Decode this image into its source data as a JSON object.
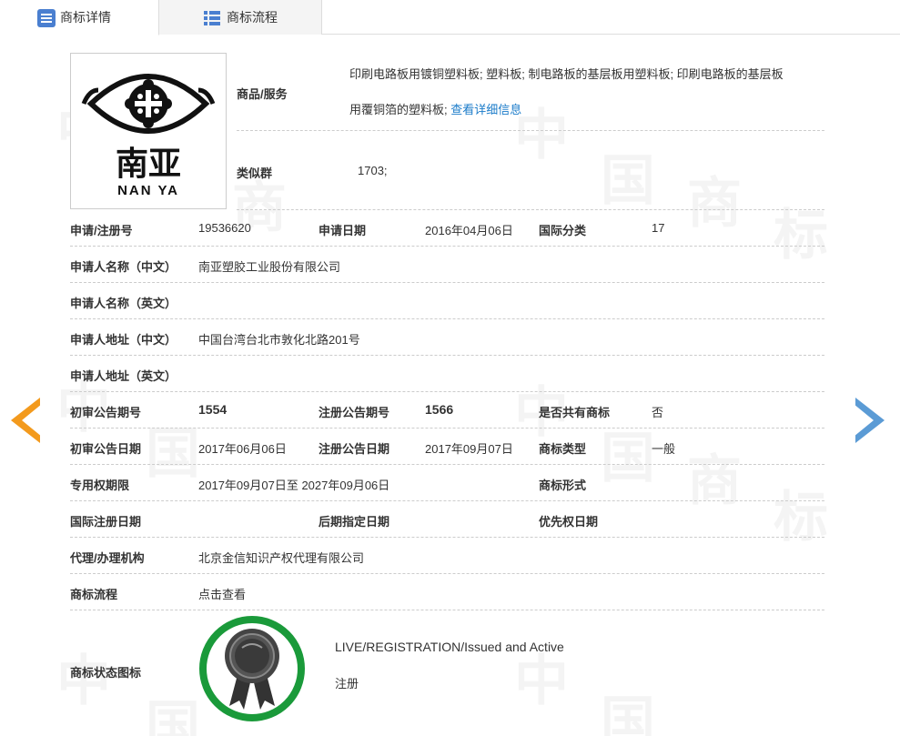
{
  "tabs": [
    {
      "label": "商标详情",
      "icon": "list-icon",
      "active": true
    },
    {
      "label": "商标流程",
      "icon": "grid-icon",
      "active": false
    }
  ],
  "logo": {
    "chinese": "南亚",
    "english": "NAN YA"
  },
  "goods_services": {
    "label": "商品/服务",
    "line1": "印刷电路板用镀铜塑料板; 塑料板; 制电路板的基层板用塑料板; 印刷电路板的基层板",
    "line2": "用覆铜箔的塑料板;",
    "link": "查看详细信息"
  },
  "similar_group": {
    "label": "类似群",
    "value": "1703;"
  },
  "rows": {
    "reg_no_label": "申请/注册号",
    "reg_no": "19536620",
    "apply_date_label": "申请日期",
    "apply_date": "2016年04月06日",
    "intl_class_label": "国际分类",
    "intl_class": "17",
    "applicant_cn_label": "申请人名称（中文）",
    "applicant_cn": "南亚塑胶工业股份有限公司",
    "applicant_en_label": "申请人名称（英文）",
    "applicant_en": "",
    "address_cn_label": "申请人地址（中文）",
    "address_cn": "中国台湾台北市敦化北路201号",
    "address_en_label": "申请人地址（英文）",
    "address_en": "",
    "prelim_no_label": "初审公告期号",
    "prelim_no": "1554",
    "reg_ann_no_label": "注册公告期号",
    "reg_ann_no": "1566",
    "shared_label": "是否共有商标",
    "shared": "否",
    "prelim_date_label": "初审公告日期",
    "prelim_date": "2017年06月06日",
    "reg_ann_date_label": "注册公告日期",
    "reg_ann_date": "2017年09月07日",
    "tm_type_label": "商标类型",
    "tm_type": "一般",
    "exclusive_label": "专用权期限",
    "exclusive": "2017年09月07日至 2027年09月06日",
    "tm_form_label": "商标形式",
    "tm_form": "",
    "intl_reg_date_label": "国际注册日期",
    "intl_reg_date": "",
    "later_date_label": "后期指定日期",
    "later_date": "",
    "priority_label": "优先权日期",
    "priority": "",
    "agency_label": "代理/办理机构",
    "agency": "北京金信知识产权代理有限公司",
    "flow_label": "商标流程",
    "flow_link": "点击查看",
    "status_icon_label": "商标状态图标"
  },
  "status": {
    "line1": "LIVE/REGISTRATION/Issued and Active",
    "line2": "注册",
    "color": "#1a9a3a"
  },
  "arrows": {
    "left_color": "#f39a1d",
    "right_color": "#5b9bd5"
  },
  "watermark": "中国商标"
}
